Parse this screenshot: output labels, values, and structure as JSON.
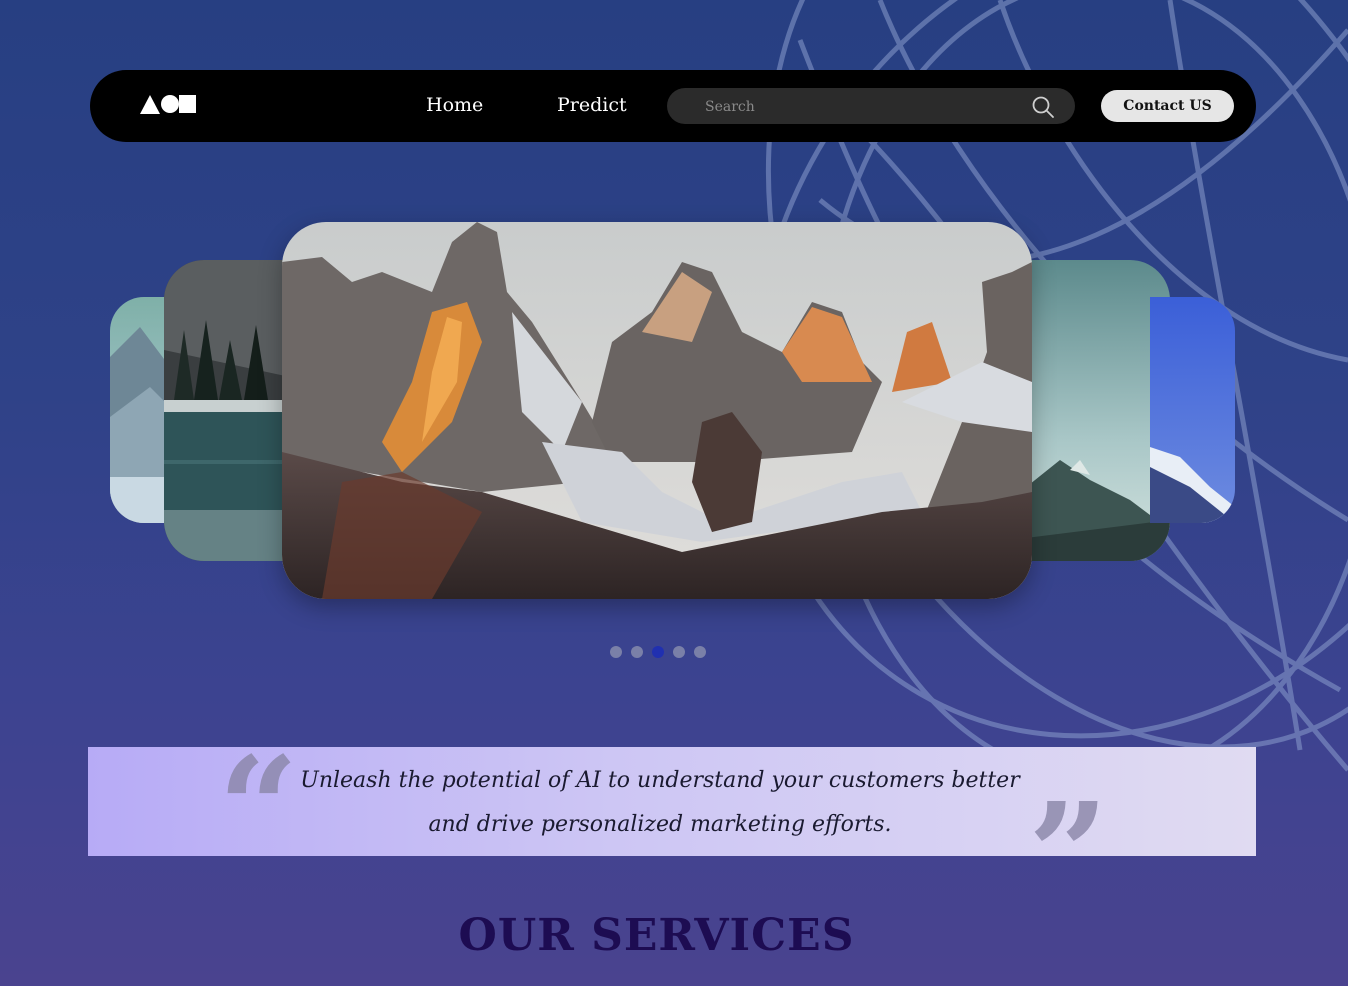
{
  "nav": {
    "links": [
      "Home",
      "Predict"
    ],
    "search_placeholder": "Search",
    "contact_label": "Contact US",
    "logo_icon": "shapes-logo-icon",
    "search_icon": "search-icon"
  },
  "carousel": {
    "slides": [
      {
        "label": "mountain-lake-slide"
      },
      {
        "label": "forest-lake-slide"
      },
      {
        "label": "rocky-peaks-sunset-slide"
      },
      {
        "label": "teal-sky-mountain-slide"
      },
      {
        "label": "blue-sky-mountain-slide"
      }
    ],
    "dot_count": 5,
    "active_index": 2
  },
  "quote": {
    "line1": "Unleash the potential of AI to understand your customers better",
    "line2": "and drive personalized marketing efforts.",
    "open_mark": "“",
    "close_mark": "”"
  },
  "services_heading": "OUR SERVICES",
  "colors": {
    "navbar": "#000000",
    "active_dot": "#2030b0",
    "heading": "#1d0c52"
  }
}
